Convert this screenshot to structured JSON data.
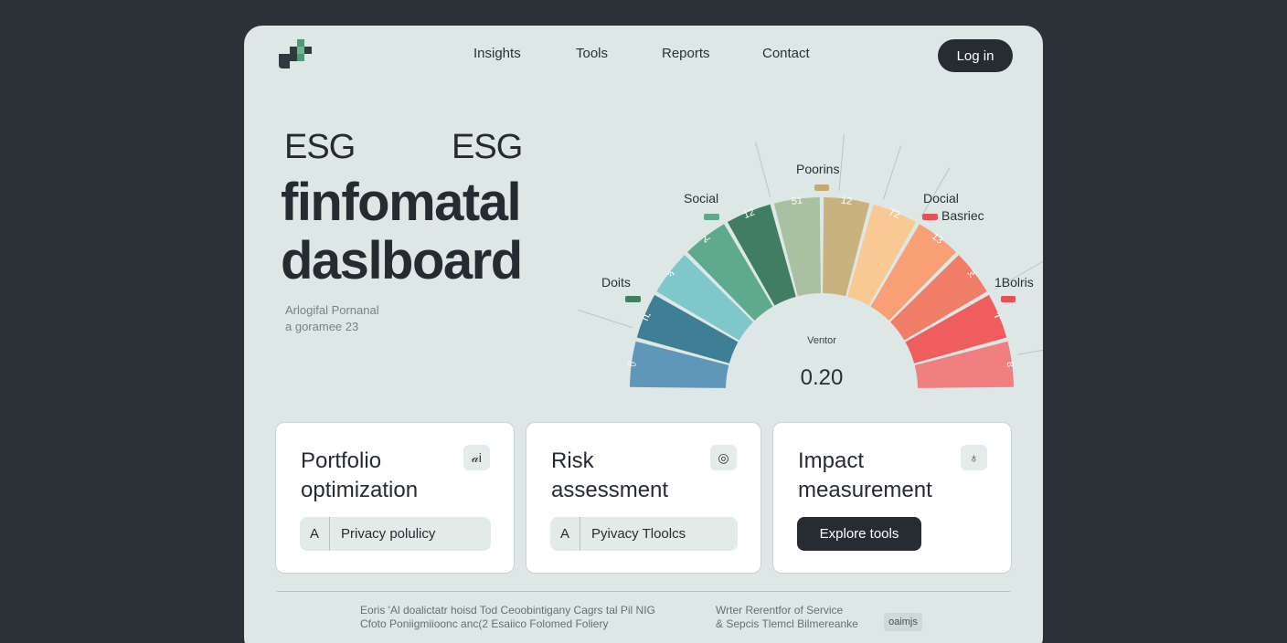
{
  "nav": {
    "items": [
      "Insights",
      "Tools",
      "Reports",
      "Contact"
    ],
    "login_label": "Log in"
  },
  "hero": {
    "line1_left": "ESG",
    "line1_right": "ESG",
    "line2": "finfomatal",
    "line3": "daslboard",
    "sub1": "Arlogifal Pornanal",
    "sub2": "a goramee 23"
  },
  "gauge": {
    "center_label": "Ventor",
    "center_value": "0.20",
    "segment_labels": [
      "ট",
      "ቢ",
      "ጓ",
      "ፈ",
      "12",
      "51",
      "12",
      "72",
      "13",
      "ጀ",
      "ፐ",
      "ឧ"
    ],
    "segment_colors": [
      "#5f97b9",
      "#3f7f95",
      "#7fc7cb",
      "#5fa98c",
      "#417d63",
      "#a9c1a0",
      "#c8b27d",
      "#f9c994",
      "#f99f76",
      "#f07d68",
      "#ef5e5d",
      "#f07f80"
    ],
    "callouts": [
      {
        "label": "Doits",
        "color": "#3f7f62"
      },
      {
        "label": "Social",
        "color": "#5fa98c"
      },
      {
        "label": "Poorins",
        "color": "#c3ac6b"
      },
      {
        "label": "Docial",
        "color": "#e85158"
      },
      {
        "label": "Basriec",
        "color": ""
      },
      {
        "label": "1Bolris",
        "color": "#e85158"
      }
    ]
  },
  "cards": [
    {
      "title": "Portfolio\noptimization",
      "icon": "ai-icon",
      "icon_glyph": "𝒶i",
      "pill_prefix": "A",
      "pill_label": "Privacy polulicy"
    },
    {
      "title": "Risk\nassessment",
      "icon": "target-icon",
      "icon_glyph": "◎",
      "pill_prefix": "A",
      "pill_label": "Pyivacy Tloolcs"
    },
    {
      "title": "Impact\nmeasurement",
      "icon": "leaf-icon",
      "icon_glyph": "♁",
      "button_label": "Explore tools"
    }
  ],
  "footer": {
    "left1": "Eoris 'Al doalictatr hoisd Tod Ceoobintigany Cagrs tal Pil NIG",
    "left2": "Cfoto Poniigmiioonc anc(2 Esaiico Folomed Foliery",
    "right1": "Wrter Rerentfor of Service",
    "right2": "& Sepcis Tlemcl Bilmereanke",
    "tag": "oaimjs"
  }
}
